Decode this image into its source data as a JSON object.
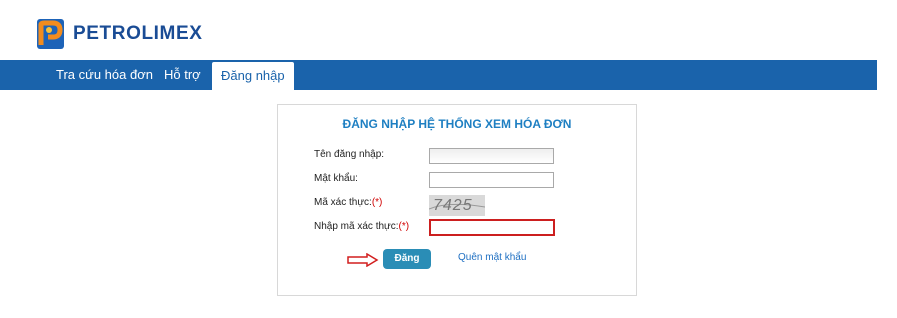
{
  "brand": {
    "name": "PETROLIMEX",
    "logo_icon": "petrolimex-logo-icon",
    "primary_color": "#1a63ab"
  },
  "nav": {
    "items": [
      {
        "label": "Tra cứu hóa đơn"
      },
      {
        "label": "Hỗ trợ"
      },
      {
        "label": "Đăng nhập",
        "active": true
      }
    ]
  },
  "login": {
    "title": "ĐĂNG NHẬP HỆ THỐNG XEM HÓA ĐƠN",
    "username_label": "Tên đăng nhập:",
    "password_label": "Mật khẩu:",
    "captcha_label": "Mã xác thực:",
    "captcha_input_label": "Nhập mã xác thực:",
    "required_mark": "(*)",
    "captcha_value": "7425",
    "username_value": "",
    "password_value": "",
    "captcha_input_value": "",
    "submit_label": "Đăng nhập",
    "forgot_label": "Quên mật khẩu"
  }
}
